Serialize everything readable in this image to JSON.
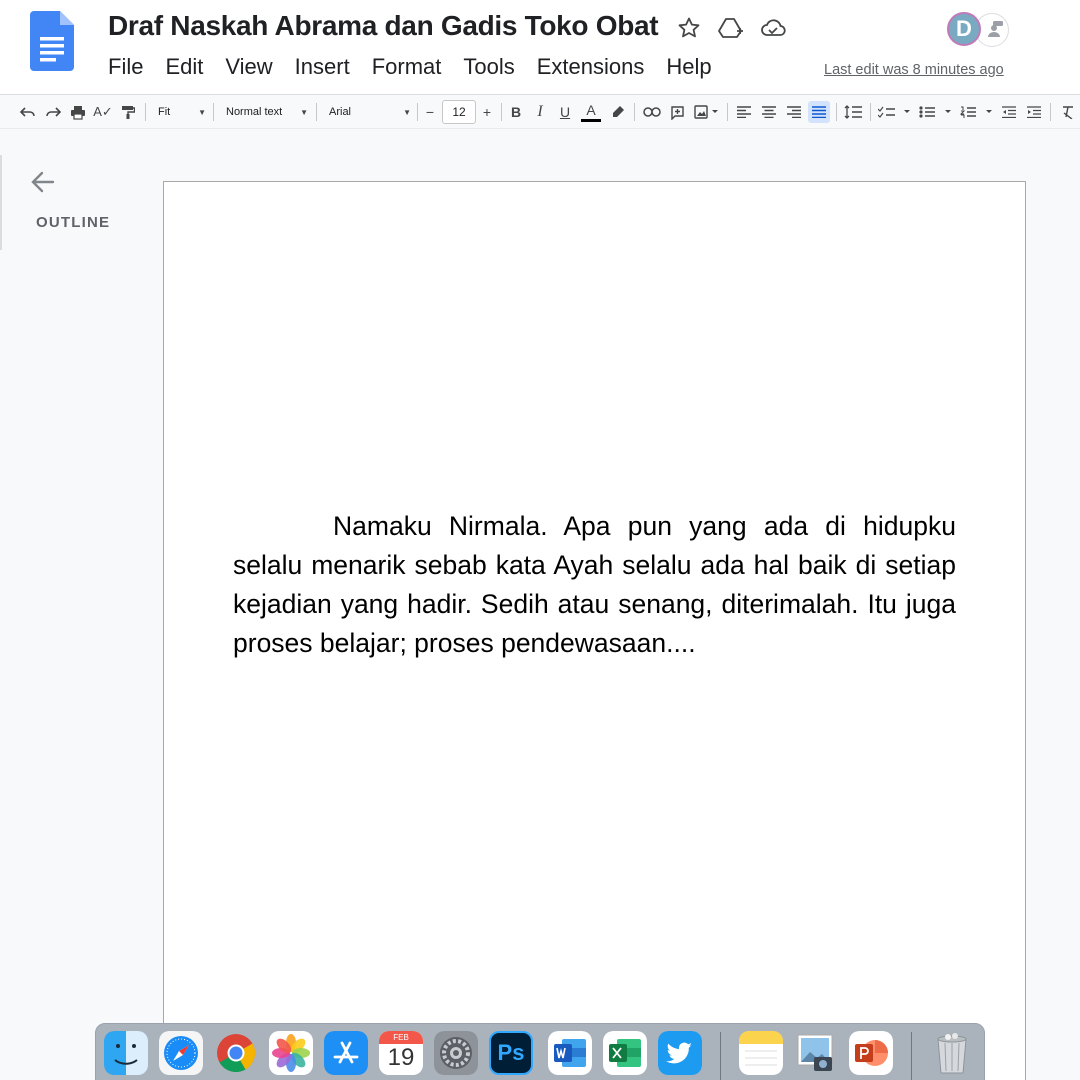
{
  "app": {
    "doc_title": "Draf Naskah Abrama dan Gadis Toko Obat",
    "last_edit": "Last edit was 8 minutes ago",
    "avatar_initial": "D"
  },
  "menu": [
    "File",
    "Edit",
    "View",
    "Insert",
    "Format",
    "Tools",
    "Extensions",
    "Help"
  ],
  "toolbar": {
    "zoom": "Fit",
    "style": "Normal text",
    "font": "Arial",
    "font_size": "12",
    "minus": "−",
    "plus": "+"
  },
  "outline": {
    "label": "OUTLINE"
  },
  "document": {
    "paragraph": "Namaku Nirmala. Apa pun yang ada di hidupku selalu menarik sebab kata Ayah selalu ada hal baik di setiap kejadian yang hadir. Sedih atau senang, diterimalah. Itu juga proses belajar; proses pendewasaan...."
  },
  "dock": {
    "calendar_month": "FEB",
    "calendar_day": "19",
    "apps": [
      "finder-icon",
      "safari-icon",
      "chrome-icon",
      "photos-icon",
      "app-store-icon",
      "calendar-icon",
      "system-preferences-icon",
      "photoshop-icon",
      "word-icon",
      "excel-icon",
      "twitter-icon",
      "notes-icon",
      "preview-icon",
      "powerpoint-icon",
      "trash-icon"
    ],
    "ps_label": "Ps"
  },
  "colors": {
    "docs_blue": "#4285f4",
    "active_align": "#d3e3fd"
  }
}
